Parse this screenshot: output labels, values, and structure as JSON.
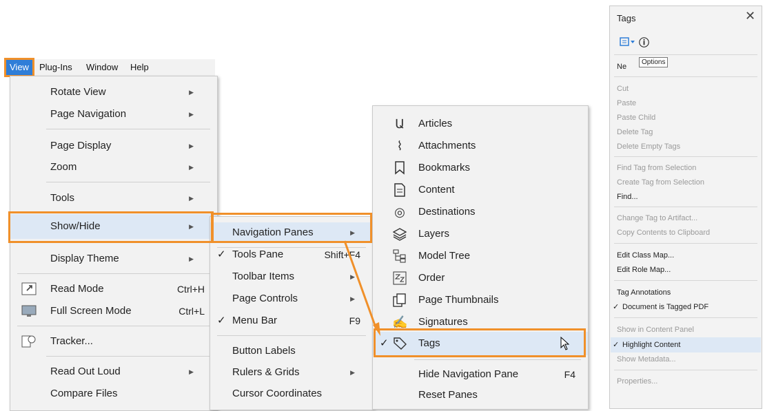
{
  "menubar": {
    "view": "View",
    "plugins": "Plug-Ins",
    "window": "Window",
    "help": "Help"
  },
  "view_menu": {
    "rotate_view": "Rotate View",
    "page_navigation": "Page Navigation",
    "page_display": "Page Display",
    "zoom": "Zoom",
    "tools": "Tools",
    "show_hide": "Show/Hide",
    "display_theme": "Display Theme",
    "read_mode": "Read Mode",
    "read_mode_shortcut": "Ctrl+H",
    "full_screen": "Full Screen Mode",
    "full_screen_shortcut": "Ctrl+L",
    "tracker": "Tracker...",
    "read_out_loud": "Read Out Loud",
    "compare_files": "Compare Files"
  },
  "show_hide_menu": {
    "navigation_panes": "Navigation Panes",
    "tools_pane": "Tools Pane",
    "tools_pane_shortcut": "Shift+F4",
    "toolbar_items": "Toolbar Items",
    "page_controls": "Page Controls",
    "menu_bar": "Menu Bar",
    "menu_bar_shortcut": "F9",
    "button_labels": "Button Labels",
    "rulers_grids": "Rulers & Grids",
    "cursor_coordinates": "Cursor Coordinates"
  },
  "nav_panes_menu": {
    "articles": "Articles",
    "attachments": "Attachments",
    "bookmarks": "Bookmarks",
    "content": "Content",
    "destinations": "Destinations",
    "layers": "Layers",
    "model_tree": "Model Tree",
    "order": "Order",
    "page_thumbnails": "Page Thumbnails",
    "signatures": "Signatures",
    "tags": "Tags",
    "hide_nav_pane": "Hide Navigation Pane",
    "hide_nav_pane_shortcut": "F4",
    "reset_panes": "Reset Panes"
  },
  "tags_panel": {
    "title": "Tags",
    "tooltip": "Options",
    "new_tag_partial": "Ne",
    "cut": "Cut",
    "paste": "Paste",
    "paste_child": "Paste Child",
    "delete_tag": "Delete Tag",
    "delete_empty_tags": "Delete Empty Tags",
    "find_tag": "Find Tag from Selection",
    "create_tag": "Create Tag from Selection",
    "find": "Find...",
    "change_tag": "Change Tag to Artifact...",
    "copy_contents": "Copy Contents to Clipboard",
    "edit_class_map": "Edit Class Map...",
    "edit_role_map": "Edit Role Map...",
    "tag_annotations": "Tag Annotations",
    "document_tagged": "Document is Tagged PDF",
    "show_in_content": "Show in Content Panel",
    "highlight_content": "Highlight Content",
    "show_metadata": "Show Metadata...",
    "properties": "Properties..."
  },
  "icons": {
    "read_mode": "read-mode-icon",
    "full_screen": "full-screen-icon",
    "tracker": "tracker-icon",
    "articles": "articles-icon",
    "attachments": "paperclip-icon",
    "bookmarks": "bookmark-icon",
    "content": "content-icon",
    "destinations": "target-icon",
    "layers": "layers-icon",
    "model_tree": "model-tree-icon",
    "order": "order-icon",
    "page_thumbnails": "page-thumbnails-icon",
    "signatures": "signature-icon",
    "tags": "tag-icon",
    "check": "check-icon",
    "close": "close-icon",
    "options": "options-menu-icon",
    "info": "info-icon"
  },
  "colors": {
    "accent_orange": "#f0902a",
    "highlight": "#dde8f5",
    "view_blue": "#2f7ed8"
  }
}
